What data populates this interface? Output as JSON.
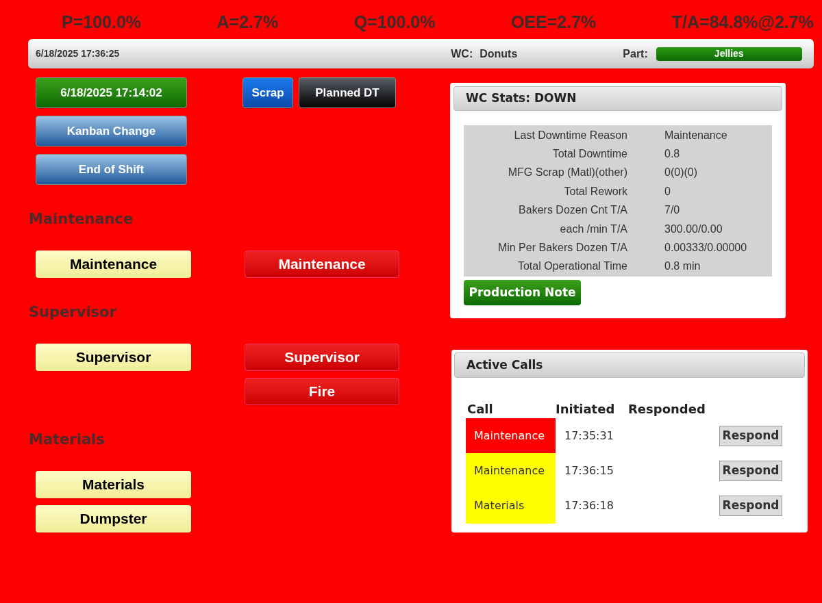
{
  "metrics": [
    "P=100.0%",
    "A=2.7%",
    "Q=100.0%",
    "OEE=2.7%",
    "T/A=84.8%@2.7%"
  ],
  "header": {
    "datetime": "6/18/2025 17:36:25",
    "wc_label": "WC:",
    "wc_value": "Donuts",
    "part_label": "Part:",
    "part_value": "Jellies"
  },
  "left_buttons": [
    {
      "label": "6/18/2025 17:14:02",
      "kind": "green"
    },
    {
      "label": "Kanban Change",
      "kind": "blue"
    },
    {
      "label": "End of Shift",
      "kind": "blue"
    }
  ],
  "right_buttons": [
    {
      "label": "Scrap",
      "kind": "scrap"
    },
    {
      "label": "Planned DT",
      "kind": "black"
    }
  ],
  "sections": [
    {
      "title": "Maintenance",
      "call_buttons": [
        "Maintenance"
      ],
      "active_buttons": [
        "Maintenance"
      ]
    },
    {
      "title": "Supervisor",
      "call_buttons": [
        "Supervisor"
      ],
      "active_buttons": [
        "Supervisor",
        "Fire"
      ]
    },
    {
      "title": "Materials",
      "call_buttons": [
        "Materials",
        "Dumpster"
      ]
    }
  ],
  "wc_stats": {
    "title": "WC Stats: DOWN",
    "rows": [
      {
        "label": "Last Downtime Reason",
        "value": "Maintenance"
      },
      {
        "label": "Total Downtime",
        "value": "0.8"
      },
      {
        "label": "MFG Scrap (Matl)(other)",
        "value": "0(0)(0)"
      },
      {
        "label": "Total Rework",
        "value": "0"
      },
      {
        "label": "Bakers Dozen Cnt T/A",
        "value": "7/0"
      },
      {
        "label": "each /min T/A",
        "value": "300.00/0.00"
      },
      {
        "label": "Min Per Bakers Dozen T/A",
        "value": "0.00333/0.00000"
      },
      {
        "label": "Total Operational Time",
        "value": "0.8 min"
      }
    ],
    "button": "Production Note"
  },
  "active_calls": {
    "title": "Active Calls",
    "columns": [
      "Call",
      "Initiated",
      "Responded"
    ],
    "rows": [
      {
        "call": "Maintenance",
        "color": "#ff0000",
        "initiated": "17:35:31",
        "button": "Respond"
      },
      {
        "call": "Maintenance",
        "color": "#ffff00",
        "initiated": "17:36:15",
        "button": "Respond"
      },
      {
        "call": "Materials",
        "color": "#ffff00",
        "initiated": "17:36:18",
        "button": "Respond"
      }
    ]
  }
}
